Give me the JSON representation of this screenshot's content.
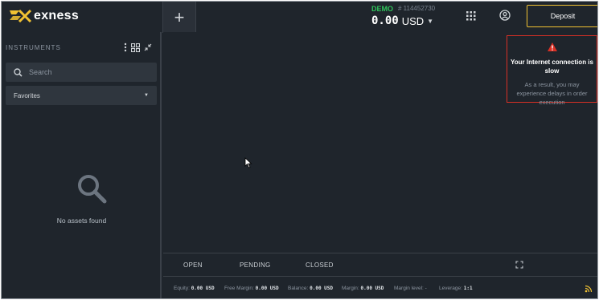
{
  "header": {
    "logo_text": "exness",
    "add_tab_label": "+",
    "account": {
      "mode": "DEMO",
      "number": "# 114452730",
      "balance": "0.00",
      "currency": "USD"
    },
    "deposit_label": "Deposit"
  },
  "sidebar": {
    "title": "INSTRUMENTS",
    "search_placeholder": "Search",
    "filter_selected": "Favorites",
    "empty_message": "No assets found"
  },
  "alert": {
    "title": "Your Internet connection is slow",
    "message": "As a result, you may experience delays in order execution"
  },
  "orders": {
    "tabs": [
      "OPEN",
      "PENDING",
      "CLOSED"
    ]
  },
  "status": {
    "equity_label": "Equity:",
    "equity_value": "0.00 USD",
    "free_margin_label": "Free Margin:",
    "free_margin_value": "0.00 USD",
    "balance_label": "Balance:",
    "balance_value": "0.00 USD",
    "margin_label": "Margin:",
    "margin_value": "0.00 USD",
    "margin_level_label": "Margin level:",
    "margin_level_value": "-",
    "leverage_label": "Leverage:",
    "leverage_value": "1:1"
  },
  "colors": {
    "accent_yellow": "#f1c232",
    "demo_green": "#2fc35a",
    "alert_red": "#d93025",
    "background": "#1f252c"
  },
  "icons": [
    "logo-icon",
    "grid-icon",
    "user-icon",
    "more-icon",
    "layout-icon",
    "collapse-icon",
    "search-icon",
    "chevron-down-icon",
    "warning-icon",
    "expand-icon",
    "signal-icon",
    "cursor-icon"
  ]
}
